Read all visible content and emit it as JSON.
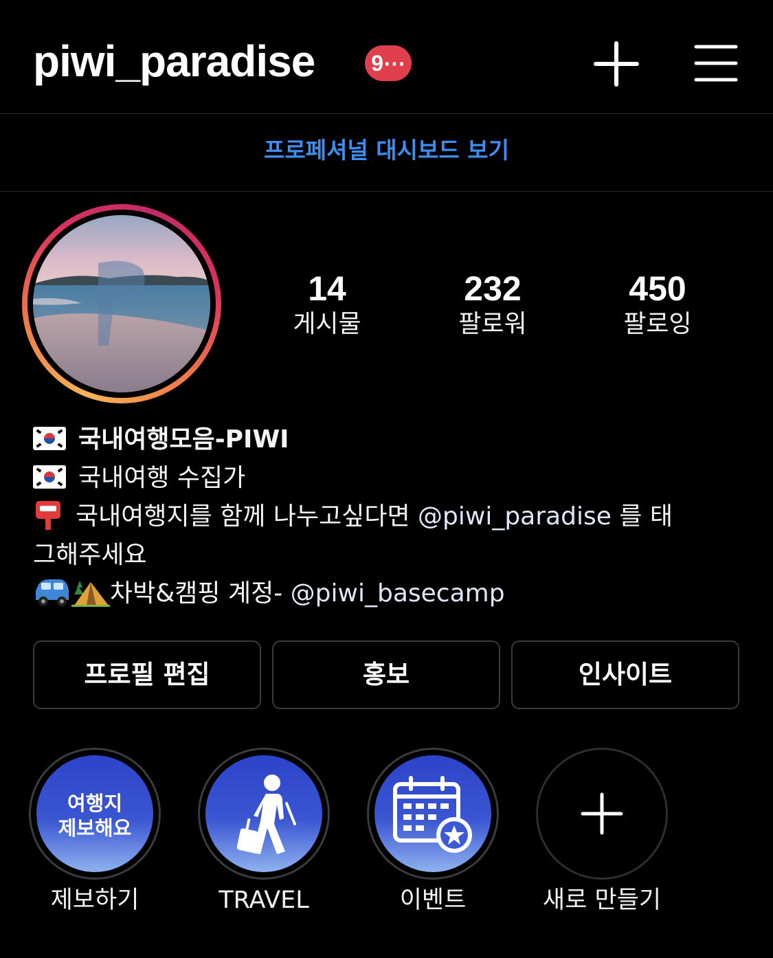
{
  "header": {
    "username": "piwi_paradise",
    "notification_badge": "9⋯",
    "icons": [
      "plus-icon",
      "hamburger-menu-icon"
    ]
  },
  "dashboard_link": "프로페셔널 대시보드 보기",
  "stats": [
    {
      "value": "14",
      "label": "게시물"
    },
    {
      "value": "232",
      "label": "팔로워"
    },
    {
      "value": "450",
      "label": "팔로잉"
    }
  ],
  "bio": {
    "name": "국내여행모음-PIWI",
    "line2": "국내여행 수집가",
    "line3_text": "국내여행지를 함께 나누고싶다면 ",
    "line3_mention": "@piwi_paradise",
    "line3_tail": " 를 태",
    "line4": "그해주세요",
    "line5_text": "차박&캠핑 계정- ",
    "line5_mention": "@piwi_basecamp"
  },
  "buttons": {
    "edit_profile": "프로필 편집",
    "promote": "홍보",
    "insights": "인사이트"
  },
  "highlights": [
    {
      "cover_text_1": "여행지",
      "cover_text_2": "제보해요",
      "label": "제보하기"
    },
    {
      "label": "TRAVEL",
      "icon": "walking-traveler-icon"
    },
    {
      "label": "이벤트",
      "icon": "calendar-star-icon"
    },
    {
      "label": "새로 만들기",
      "icon": "plus-icon"
    }
  ],
  "colors": {
    "background": "#000000",
    "link_blue": "#3c8ef0",
    "badge_red": "#e0404d",
    "highlight_blue": "#3a56d2"
  }
}
